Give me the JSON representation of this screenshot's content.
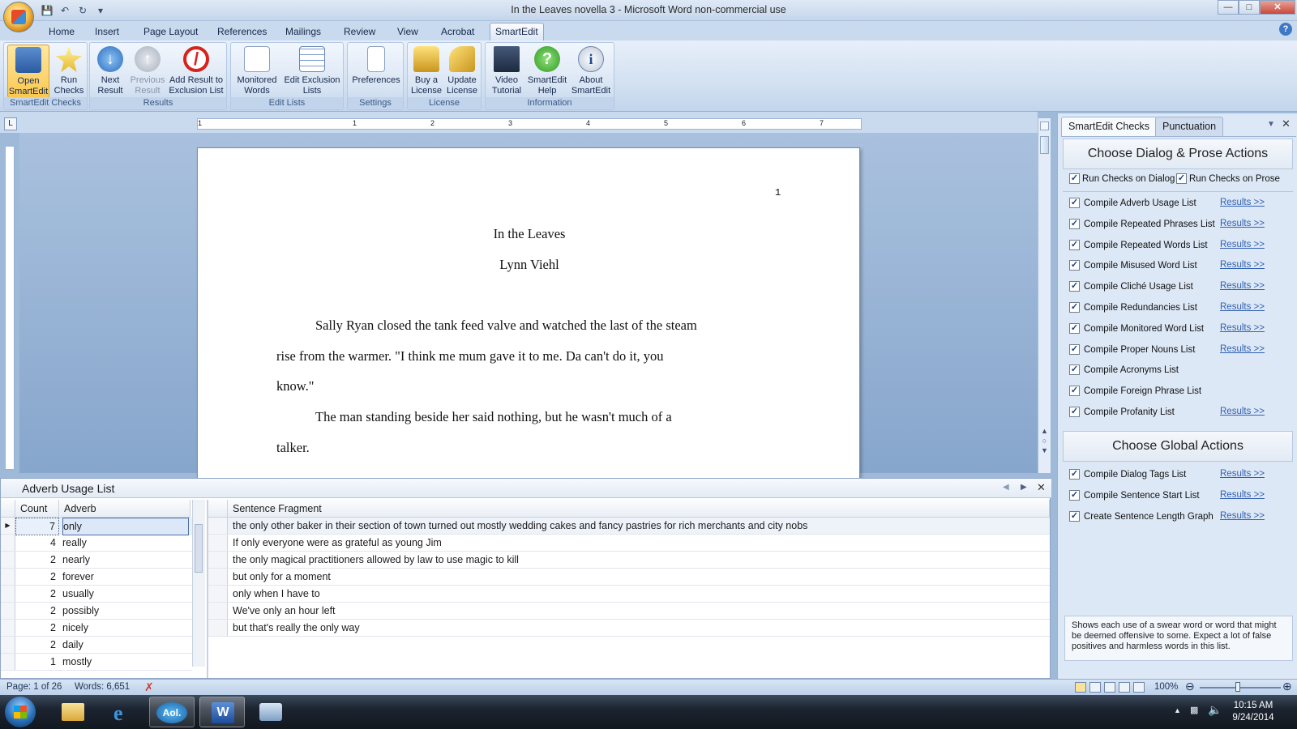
{
  "window": {
    "title": "In the Leaves novella 3 - Microsoft Word non-commercial use"
  },
  "tabs": [
    "Home",
    "Insert",
    "Page Layout",
    "References",
    "Mailings",
    "Review",
    "View",
    "Acrobat",
    "SmartEdit"
  ],
  "active_tab": "SmartEdit",
  "ribbon": {
    "groups": [
      {
        "label": "SmartEdit Checks",
        "buttons": [
          {
            "label": "Open SmartEdit"
          },
          {
            "label": "Run Checks"
          }
        ]
      },
      {
        "label": "Results",
        "buttons": [
          {
            "label": "Next Result"
          },
          {
            "label": "Previous Result"
          },
          {
            "label": "Add Result to Exclusion List"
          }
        ]
      },
      {
        "label": "Edit Lists",
        "buttons": [
          {
            "label": "Monitored Words"
          },
          {
            "label": "Edit Exclusion Lists"
          }
        ]
      },
      {
        "label": "Settings",
        "buttons": [
          {
            "label": "Preferences"
          }
        ]
      },
      {
        "label": "License",
        "buttons": [
          {
            "label": "Buy a License"
          },
          {
            "label": "Update License"
          }
        ]
      },
      {
        "label": "Information",
        "buttons": [
          {
            "label": "Video Tutorial"
          },
          {
            "label": "SmartEdit Help"
          },
          {
            "label": "About SmartEdit"
          }
        ]
      }
    ]
  },
  "ruler": {
    "numbers": [
      "1",
      "1",
      "2",
      "3",
      "4",
      "5",
      "6",
      "7"
    ]
  },
  "document": {
    "page_number": "1",
    "title": "In the Leaves",
    "author": "Lynn Viehl",
    "lines": [
      "Sally Ryan closed the tank feed valve and watched the last of the steam",
      "rise from the warmer.  \"I think me mum gave it to me. Da can't do it, you",
      "know.\"",
      "The man standing beside her said nothing, but he wasn't much of a",
      "talker."
    ]
  },
  "bottom_panel": {
    "title": "Adverb Usage List",
    "columns": {
      "count": "Count",
      "adverb": "Adverb",
      "fragment": "Sentence Fragment"
    },
    "rows": [
      {
        "count": "7",
        "adverb": "only"
      },
      {
        "count": "4",
        "adverb": "really"
      },
      {
        "count": "2",
        "adverb": "nearly"
      },
      {
        "count": "2",
        "adverb": "forever"
      },
      {
        "count": "2",
        "adverb": "usually"
      },
      {
        "count": "2",
        "adverb": "possibly"
      },
      {
        "count": "2",
        "adverb": "nicely"
      },
      {
        "count": "2",
        "adverb": "daily"
      },
      {
        "count": "1",
        "adverb": "mostly"
      }
    ],
    "fragments": [
      "the only other baker in their section of town turned out mostly wedding cakes and fancy pastries for rich merchants and city nobs",
      "If only everyone were as grateful as young Jim",
      "the only magical practitioners allowed by law to use magic to kill",
      "but only for a moment",
      "only when I have to",
      "We've only an hour left",
      "but that's really the only way"
    ]
  },
  "right_pane": {
    "tabs": [
      "SmartEdit Checks",
      "Punctuation"
    ],
    "dialog_section_title": "Choose Dialog & Prose Actions",
    "run_dialog_label": "Run Checks on Dialog",
    "run_prose_label": "Run Checks on Prose",
    "results_link": "Results >>",
    "checks": [
      "Compile Adverb Usage List",
      "Compile Repeated Phrases List",
      "Compile Repeated Words List",
      "Compile Misused Word List",
      "Compile Cliché Usage List",
      "Compile Redundancies List",
      "Compile Monitored Word List",
      "Compile Proper Nouns List",
      "Compile Acronyms List",
      "Compile Foreign Phrase List",
      "Compile Profanity List"
    ],
    "global_section_title": "Choose Global Actions",
    "global_checks": [
      "Compile Dialog Tags List",
      "Compile Sentence Start List",
      "Create Sentence Length Graph"
    ],
    "description": "Shows each use of a swear word or word that might be deemed offensive to some. Expect a lot of false positives and harmless words in this list."
  },
  "status": {
    "page": "Page: 1 of 26",
    "words": "Words: 6,651",
    "zoom": "100%"
  },
  "taskbar": {
    "time": "10:15 AM",
    "date": "9/24/2014",
    "aol_label": "Aol."
  }
}
